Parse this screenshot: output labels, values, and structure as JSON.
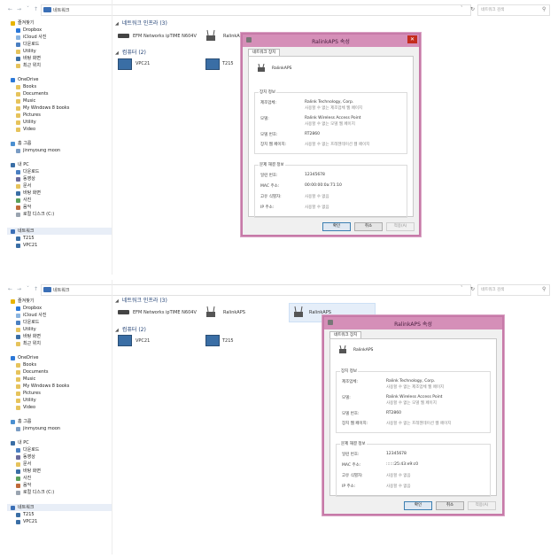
{
  "colors": {
    "accent": "#3b6fb6",
    "dialog_border": "#c77aa8",
    "dialog_title": "#d58fb8",
    "close": "#c42b1c"
  },
  "panels": [
    {
      "address": {
        "crumb": "네트워크",
        "search_placeholder": "네트워크 검색"
      },
      "sidebar": {
        "favorites": {
          "label": "즐겨찾기",
          "items": [
            "Dropbox",
            "iCloud 사진",
            "다운로드",
            "Utility",
            "바탕 화면",
            "최근 위치"
          ]
        },
        "onedrive": {
          "label": "OneDrive",
          "items": [
            "Books",
            "Documents",
            "Music",
            "My Windows 8 books",
            "Pictures",
            "Utility",
            "Video"
          ]
        },
        "homegroup": {
          "label": "홈 그룹",
          "items": [
            "jinmyoung moon"
          ]
        },
        "pc": {
          "label": "내 PC",
          "items": [
            "다운로드",
            "동영상",
            "문서",
            "바탕 화면",
            "사진",
            "음악",
            "로컬 디스크 (C:)"
          ]
        },
        "network": {
          "label": "네트워크",
          "items": [
            "T215",
            "VPC21"
          ]
        }
      },
      "main": {
        "infra_section": "네트워크 인프라 (3)",
        "infra_items": [
          "EFM Networks ipTIME N604V",
          "RalinkAPS"
        ],
        "computer_section": "컴퓨터 (2)",
        "computer_items": [
          "VPC21",
          "T215"
        ]
      },
      "dialog": {
        "title": "RalinkAPS 속성",
        "close": "✕",
        "tab": "네트워크 장치",
        "device_name": "RalinkAPS",
        "device_info": {
          "label": "장치 정보",
          "rows": [
            {
              "label": "제조업체:",
              "value": "Ralink Technology, Corp.",
              "sub": "사용할 수 없는 제조업체 웹 페이지"
            },
            {
              "label": "모델:",
              "value": "Ralink Wireless Access Point",
              "sub": "사용할 수 없는 모델 웹 페이지"
            },
            {
              "label": "모델 번호:",
              "value": "RT2860",
              "sub": ""
            },
            {
              "label": "장치 웹 페이지:",
              "value": "사용할 수 없는 프레젠테이션 웹 페이지",
              "sub": ""
            }
          ]
        },
        "troubleshoot": {
          "label": "문제 해결 정보",
          "rows": [
            {
              "label": "일련 번호:",
              "value": "12345678"
            },
            {
              "label": "MAC 주소:",
              "value": "00:00:00:0a:71:10"
            },
            {
              "label": "고유 식별자:",
              "value": "사용할 수 없음"
            },
            {
              "label": "IP 주소:",
              "value": "사용할 수 없음"
            }
          ]
        },
        "buttons": {
          "ok": "확인",
          "cancel": "취소",
          "apply": "적용(A)"
        }
      }
    },
    {
      "address": {
        "crumb": "네트워크",
        "search_placeholder": "네트워크 검색"
      },
      "sidebar": {
        "favorites": {
          "label": "즐겨찾기",
          "items": [
            "Dropbox",
            "iCloud 사진",
            "다운로드",
            "Utility",
            "바탕 화면",
            "최근 위치"
          ]
        },
        "onedrive": {
          "label": "OneDrive",
          "items": [
            "Books",
            "Documents",
            "Music",
            "My Windows 8 books",
            "Pictures",
            "Utility",
            "Video"
          ]
        },
        "homegroup": {
          "label": "홈 그룹",
          "items": [
            "jinmyoung moon"
          ]
        },
        "pc": {
          "label": "내 PC",
          "items": [
            "다운로드",
            "동영상",
            "문서",
            "바탕 화면",
            "사진",
            "음악",
            "로컬 디스크 (C:)"
          ]
        },
        "network": {
          "label": "네트워크",
          "items": [
            "T215",
            "VPC21"
          ]
        }
      },
      "main": {
        "infra_section": "네트워크 인프라 (3)",
        "infra_items": [
          "EFM Networks ipTIME N604V",
          "RalinkAPS",
          "RalinkAPS"
        ],
        "computer_section": "컴퓨터 (2)",
        "computer_items": [
          "VPC21",
          "T215"
        ]
      },
      "dialog": {
        "title": "RalinkAPS 속성",
        "close": "✕",
        "tab": "네트워크 장치",
        "device_name": "RalinkAPS",
        "device_info": {
          "label": "장치 정보",
          "rows": [
            {
              "label": "제조업체:",
              "value": "Ralink Technology, Corp.",
              "sub": "사용할 수 없는 제조업체 웹 페이지"
            },
            {
              "label": "모델:",
              "value": "Ralink Wireless Access Point",
              "sub": "사용할 수 없는 모델 웹 페이지"
            },
            {
              "label": "모델 번호:",
              "value": "RT2860",
              "sub": ""
            },
            {
              "label": "장치 웹 페이지:",
              "value": "사용할 수 없는 프레젠테이션 웹 페이지",
              "sub": ""
            }
          ]
        },
        "troubleshoot": {
          "label": "문제 해결 정보",
          "rows": [
            {
              "label": "일련 번호:",
              "value": "12345678"
            },
            {
              "label": "MAC 주소:",
              "value": "::::::25:43:e9:c0"
            },
            {
              "label": "고유 식별자:",
              "value": "사용할 수 없음"
            },
            {
              "label": "IP 주소:",
              "value": "사용할 수 없음"
            }
          ]
        },
        "buttons": {
          "ok": "확인",
          "cancel": "취소",
          "apply": "적용(A)"
        }
      }
    }
  ]
}
